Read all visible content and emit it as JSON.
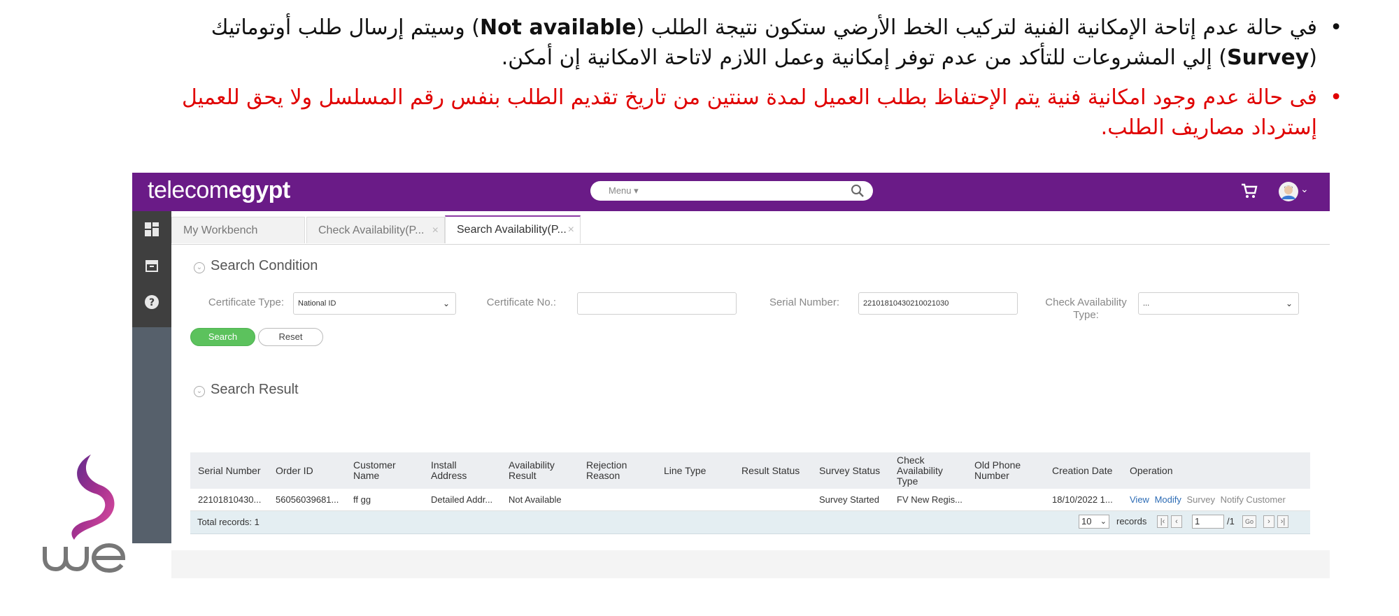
{
  "notes": {
    "note1": {
      "part1": "في حالة عدم إتاحة الإمكانية الفنية لتركيب الخط الأرضي ستكون نتيجة الطلب (",
      "bold1": "Not available",
      "part2": ") وسيتم إرسال طلب أوتوماتيك (",
      "bold2": "Survey",
      "part3": ") إلي المشروعات للتأكد من عدم توفر إمكانية وعمل اللازم لاتاحة الامكانية إن أمكن."
    },
    "note2": "فى حالة عدم وجود امكانية فنية يتم الإحتفاظ بطلب العميل لمدة سنتين من تاريخ تقديم الطلب بنفس رقم المسلسل ولا يحق للعميل إسترداد مصاريف الطلب.",
    "bullet": "•"
  },
  "colors": {
    "note_red": "#e00000",
    "topbar": "#6a1b87",
    "search_button": "#5cc25d",
    "link": "#2d6cb5"
  },
  "header": {
    "brand_light": "telecom",
    "brand_bold": "egypt",
    "menu_label": "Menu ▾"
  },
  "tabs": [
    {
      "label": "My Workbench"
    },
    {
      "label": "Check Availability(P..."
    },
    {
      "label": "Search Availability(P..."
    }
  ],
  "search_condition": {
    "title": "Search Condition",
    "certificate_type_label": "Certificate Type:",
    "certificate_type_value": "National ID",
    "certificate_no_label": "Certificate No.:",
    "certificate_no_value": "",
    "serial_number_label": "Serial Number:",
    "serial_number_value": "22101810430210021030",
    "check_type_label": "Check Availability Type:",
    "check_type_value": "...",
    "search_button": "Search",
    "reset_button": "Reset"
  },
  "search_result": {
    "title": "Search Result",
    "columns": [
      "Serial Number",
      "Order ID",
      "Customer Name",
      "Install Address",
      "Availability Result",
      "Rejection Reason",
      "Line Type",
      "Result Status",
      "Survey Status",
      "Check Availability Type",
      "Old Phone Number",
      "Creation Date",
      "Operation"
    ],
    "rows": [
      {
        "serial_number": "22101810430...",
        "order_id": "56056039681...",
        "customer_name": "ff gg",
        "install_address": "Detailed Addr...",
        "availability_result": "Not Available",
        "rejection_reason": "",
        "line_type": "",
        "result_status": "",
        "survey_status": "Survey Started",
        "check_type": "FV New Regis...",
        "old_phone": "",
        "creation_date": "18/10/2022 1...",
        "operations": [
          "View",
          "Modify",
          "Survey",
          "Notify Customer"
        ]
      }
    ],
    "total": "Total records: 1",
    "page_size": "10",
    "records_label": "records",
    "page_current": "1",
    "page_total": "/1",
    "go_label": "Go"
  }
}
